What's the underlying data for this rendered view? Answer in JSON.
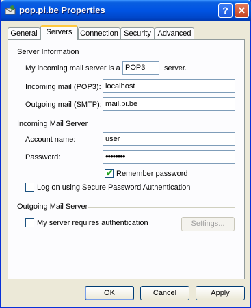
{
  "window": {
    "title": "pop.pi.be Properties",
    "help_glyph": "?",
    "close_glyph": "✕"
  },
  "tabs": [
    {
      "label": "General"
    },
    {
      "label": "Servers"
    },
    {
      "label": "Connection"
    },
    {
      "label": "Security"
    },
    {
      "label": "Advanced"
    }
  ],
  "server_info": {
    "group_label": "Server Information",
    "incoming_type_prefix": "My incoming mail server is a",
    "incoming_type_value": "POP3",
    "incoming_type_suffix": "server.",
    "incoming_label": "Incoming mail (POP3):",
    "incoming_value": "localhost",
    "outgoing_label": "Outgoing mail (SMTP):",
    "outgoing_value": "mail.pi.be"
  },
  "incoming_server": {
    "group_label": "Incoming Mail Server",
    "account_label": "Account name:",
    "account_value": "user",
    "password_label": "Password:",
    "password_value": "••••••••",
    "remember_label": "Remember password",
    "remember_checked": true,
    "spa_label": "Log on using Secure Password Authentication",
    "spa_checked": false
  },
  "outgoing_server": {
    "group_label": "Outgoing Mail Server",
    "auth_label": "My server requires authentication",
    "auth_checked": false,
    "settings_label": "Settings..."
  },
  "buttons": {
    "ok": "OK",
    "cancel": "Cancel",
    "apply": "Apply"
  },
  "colors": {
    "titlebar": "#0054e3",
    "face": "#ece9d8",
    "panel": "#fcfcfe",
    "checkmark": "#21a121"
  }
}
